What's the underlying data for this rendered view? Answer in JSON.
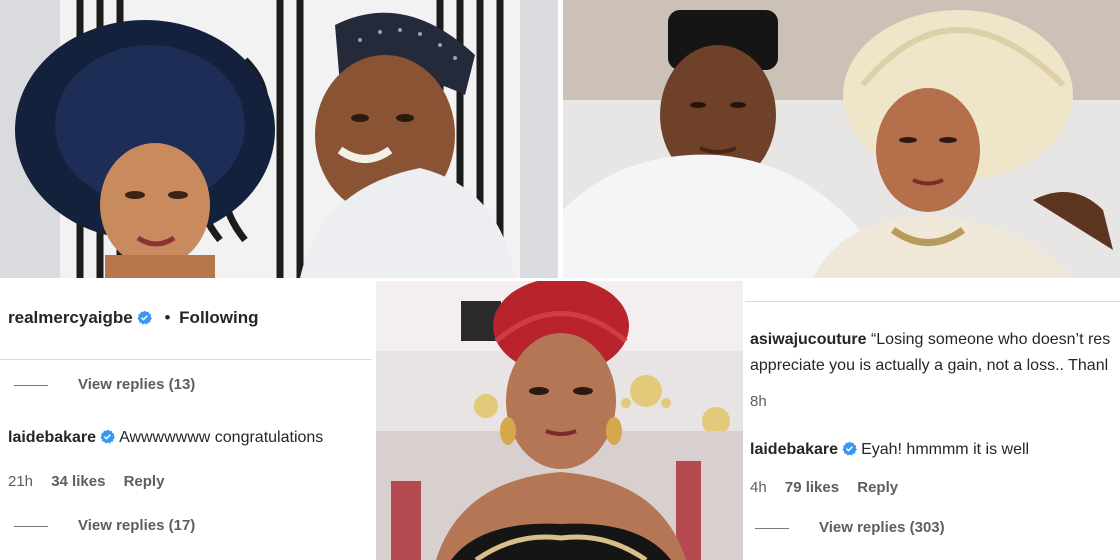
{
  "left_panel": {
    "header": {
      "username": "realmercyaigbe",
      "separator": "•",
      "follow_status": "Following"
    },
    "view_replies_1": "View replies (13)",
    "comment": {
      "username": "laidebakare",
      "text": "Awwwwwww congratulations"
    },
    "comment_meta": {
      "time": "21h",
      "likes": "34 likes",
      "reply": "Reply"
    },
    "view_replies_2": "View replies (17)"
  },
  "right_panel": {
    "comment_1": {
      "username": "asiwajucouture",
      "text_line1": "“Losing someone who doesn’t res",
      "text_line2": "appreciate you is actually a gain, not a loss.. Thanl",
      "time": "8h"
    },
    "comment_2": {
      "username": "laidebakare",
      "text": "Eyah! hmmmm it is well"
    },
    "comment_meta": {
      "time": "4h",
      "likes": "79 likes",
      "reply": "Reply"
    },
    "view_replies": "View replies (303)"
  },
  "colors": {
    "verified_badge": "#3897f0",
    "text": "#262626",
    "muted": "#5e5e5e"
  },
  "icons": [
    "verified-badge-icon"
  ]
}
